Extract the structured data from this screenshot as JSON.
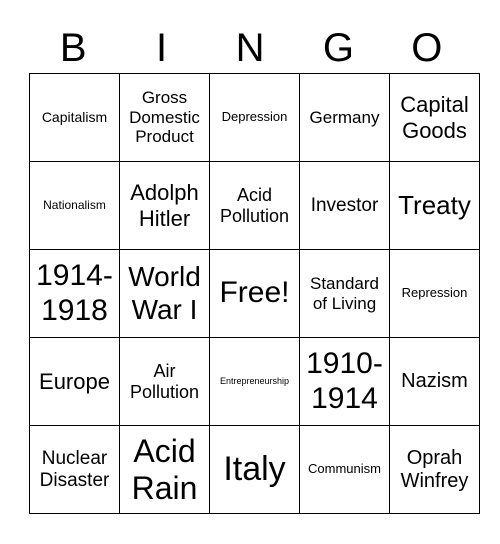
{
  "header": [
    "B",
    "I",
    "N",
    "G",
    "O"
  ],
  "cells": [
    [
      "Capitalism",
      "Gross\nDomestic\nProduct",
      "Depression",
      "Germany",
      "Capital\nGoods"
    ],
    [
      "Nationalism",
      "Adolph\nHitler",
      "Acid\nPollution",
      "Investor",
      "Treaty"
    ],
    [
      "1914-\n1918",
      "World\nWar I",
      "Free!",
      "Standard\nof Living",
      "Repression"
    ],
    [
      "Europe",
      "Air\nPollution",
      "Entrepreneurship",
      "1910-\n1914",
      "Nazism"
    ],
    [
      "Nuclear\nDisaster",
      "Acid\nRain",
      "Italy",
      "Communism",
      "Oprah\nWinfrey"
    ]
  ]
}
